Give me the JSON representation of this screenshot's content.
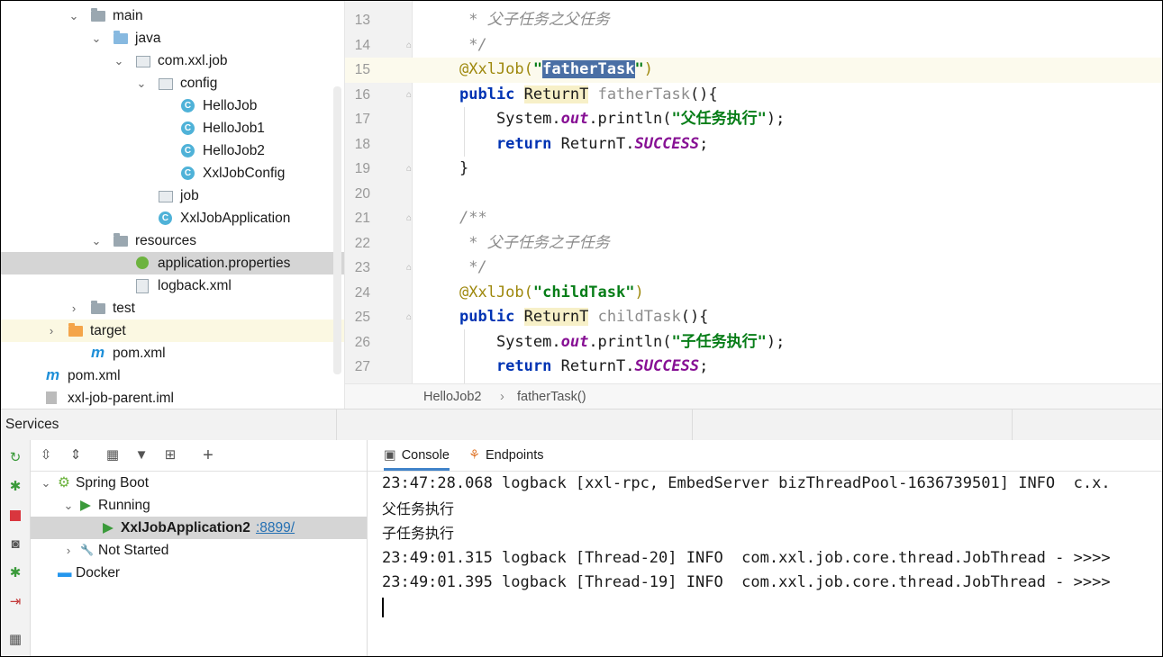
{
  "project_tree": {
    "rows": [
      {
        "label": "main",
        "arrow": "⌄",
        "icon": "folder"
      },
      {
        "label": "java",
        "arrow": "⌄",
        "icon": "folder-blue"
      },
      {
        "label": "com.xxl.job",
        "arrow": "⌄",
        "icon": "package"
      },
      {
        "label": "config",
        "arrow": "⌄",
        "icon": "package"
      },
      {
        "label": "HelloJob",
        "icon": "class"
      },
      {
        "label": "HelloJob1",
        "icon": "class"
      },
      {
        "label": "HelloJob2",
        "icon": "class"
      },
      {
        "label": "XxlJobConfig",
        "icon": "class"
      },
      {
        "label": "job",
        "icon": "package"
      },
      {
        "label": "XxlJobApplication",
        "icon": "spring-class"
      },
      {
        "label": "resources",
        "arrow": "⌄",
        "icon": "folder-resources"
      },
      {
        "label": "application.properties",
        "icon": "spring-properties",
        "selected": true
      },
      {
        "label": "logback.xml",
        "icon": "xml-file"
      },
      {
        "label": "test",
        "arrow": "›",
        "icon": "folder"
      },
      {
        "label": "target",
        "arrow": "›",
        "icon": "folder-orange",
        "highlighted": true
      },
      {
        "label": "pom.xml",
        "icon": "maven"
      },
      {
        "label": "pom.xml",
        "icon": "maven"
      },
      {
        "label": "xxl-job-parent.iml",
        "icon": "iml-file"
      }
    ]
  },
  "editor": {
    "current_line": "15",
    "lines": [
      {
        "n": "13",
        "parts": [
          {
            "c": "cm",
            "t": " * 父子任务之父任务"
          }
        ]
      },
      {
        "n": "14",
        "parts": [
          {
            "c": "cm",
            "t": " */"
          }
        ]
      },
      {
        "n": "15",
        "parts": [
          {
            "c": "an",
            "t": "@XxlJob("
          },
          {
            "c": "str",
            "t": "\""
          },
          {
            "c": "str hl",
            "t": "fatherTask"
          },
          {
            "c": "str",
            "t": "\""
          },
          {
            "c": "an",
            "t": ")"
          }
        ]
      },
      {
        "n": "16",
        "parts": [
          {
            "c": "kw",
            "t": "public"
          },
          {
            "c": "",
            "t": " "
          },
          {
            "c": "ty",
            "t": "ReturnT"
          },
          {
            "c": "",
            "t": " "
          },
          {
            "c": "mth",
            "t": "fatherTask"
          },
          {
            "c": "",
            "t": "(){"
          }
        ]
      },
      {
        "n": "17",
        "parts": [
          {
            "c": "",
            "t": "    System."
          },
          {
            "c": "fld",
            "t": "out"
          },
          {
            "c": "",
            "t": ".println("
          },
          {
            "c": "str",
            "t": "\"父任务执行\""
          },
          {
            "c": "",
            "t": ");"
          }
        ]
      },
      {
        "n": "18",
        "parts": [
          {
            "c": "kw",
            "t": "    return"
          },
          {
            "c": "",
            "t": " ReturnT."
          },
          {
            "c": "fld",
            "t": "SUCCESS"
          },
          {
            "c": "",
            "t": ";"
          }
        ]
      },
      {
        "n": "19",
        "parts": [
          {
            "c": "",
            "t": "}"
          }
        ]
      },
      {
        "n": "20",
        "parts": [
          {
            "c": "",
            "t": ""
          }
        ]
      },
      {
        "n": "21",
        "parts": [
          {
            "c": "cm",
            "t": "/**"
          }
        ]
      },
      {
        "n": "22",
        "parts": [
          {
            "c": "cm",
            "t": " * 父子任务之子任务"
          }
        ]
      },
      {
        "n": "23",
        "parts": [
          {
            "c": "cm",
            "t": " */"
          }
        ]
      },
      {
        "n": "24",
        "parts": [
          {
            "c": "an",
            "t": "@XxlJob("
          },
          {
            "c": "str",
            "t": "\"childTask\""
          },
          {
            "c": "an",
            "t": ")"
          }
        ]
      },
      {
        "n": "25",
        "parts": [
          {
            "c": "kw",
            "t": "public"
          },
          {
            "c": "",
            "t": " "
          },
          {
            "c": "ty",
            "t": "ReturnT"
          },
          {
            "c": "",
            "t": " "
          },
          {
            "c": "mth",
            "t": "childTask"
          },
          {
            "c": "",
            "t": "(){"
          }
        ]
      },
      {
        "n": "26",
        "parts": [
          {
            "c": "",
            "t": "    System."
          },
          {
            "c": "fld",
            "t": "out"
          },
          {
            "c": "",
            "t": ".println("
          },
          {
            "c": "str",
            "t": "\"子任务执行\""
          },
          {
            "c": "",
            "t": ");"
          }
        ]
      },
      {
        "n": "27",
        "parts": [
          {
            "c": "kw",
            "t": "    return"
          },
          {
            "c": "",
            "t": " ReturnT."
          },
          {
            "c": "fld",
            "t": "SUCCESS"
          },
          {
            "c": "",
            "t": ";"
          }
        ]
      }
    ],
    "breadcrumb": {
      "class": "HelloJob2",
      "separator": "›",
      "method": "fatherTask()"
    }
  },
  "services": {
    "title": "Services",
    "tree": [
      {
        "label": "Spring Boot",
        "arrow": "⌄",
        "icon": "spring-boot-icon"
      },
      {
        "label": "Running",
        "arrow": "⌄",
        "icon": "run-icon"
      },
      {
        "label": "XxlJobApplication2",
        "port": ":8899/",
        "icon": "run-icon",
        "selected": true
      },
      {
        "label": "Not Started",
        "arrow": "›",
        "icon": "wrench-icon"
      },
      {
        "label": "Docker",
        "icon": "docker-icon"
      }
    ],
    "tabs": [
      {
        "label": "Console",
        "icon": "console-icon",
        "active": true
      },
      {
        "label": "Endpoints",
        "icon": "endpoints-icon"
      }
    ],
    "console_lines": [
      "23:47:28.068 logback [xxl-rpc, EmbedServer bizThreadPool-1636739501] INFO  c.x.",
      "父任务执行",
      "子任务执行",
      "23:49:01.315 logback [Thread-20] INFO  com.xxl.job.core.thread.JobThread - >>>>",
      "23:49:01.395 logback [Thread-19] INFO  com.xxl.job.core.thread.JobThread - >>>>"
    ]
  },
  "colors": {
    "selection": "#d5d5d5",
    "keyword": "#0033b3",
    "string": "#067d17",
    "annotation": "#9e880d",
    "field": "#871094",
    "accent": "#4083c9"
  }
}
